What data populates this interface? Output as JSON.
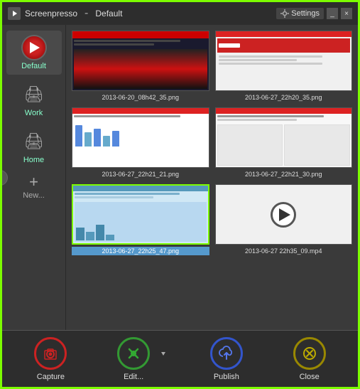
{
  "window": {
    "title": "Screenpresso",
    "profile": "Default",
    "settings_label": "Settings",
    "minimize_label": "_",
    "close_label": "×"
  },
  "sidebar": {
    "items": [
      {
        "id": "default",
        "label": "Default",
        "active": true
      },
      {
        "id": "work",
        "label": "Work"
      },
      {
        "id": "home",
        "label": "Home"
      }
    ],
    "new_label": "New...",
    "collapse_icon": "‹"
  },
  "gallery": {
    "items": [
      {
        "id": 1,
        "filename": "2013-06-20_08h42_35.png",
        "selected": false,
        "type": "image"
      },
      {
        "id": 2,
        "filename": "2013-06-27_22h20_35.png",
        "selected": false,
        "type": "image"
      },
      {
        "id": 3,
        "filename": "2013-06-27_22h21_21.png",
        "selected": false,
        "type": "image"
      },
      {
        "id": 4,
        "filename": "2013-06-27_22h21_30.png",
        "selected": false,
        "type": "image"
      },
      {
        "id": 5,
        "filename": "2013-06-27_22h25_47.png",
        "selected": true,
        "type": "image"
      },
      {
        "id": 6,
        "filename": "2013-06-27 22h35_09.mp4",
        "selected": false,
        "type": "video"
      }
    ]
  },
  "toolbar": {
    "capture_label": "Capture",
    "edit_label": "Edit...",
    "publish_label": "Publish",
    "close_label": "Close"
  }
}
